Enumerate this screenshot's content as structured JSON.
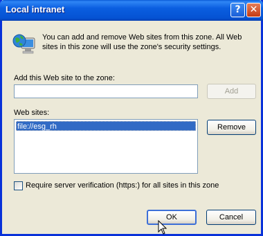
{
  "window": {
    "title": "Local intranet",
    "help_glyph": "?",
    "close_glyph": "✕"
  },
  "description": "You can add and remove Web sites from this zone. All Web sites in this zone will use the zone's security settings.",
  "add_site": {
    "label": "Add this Web site to the zone:",
    "value": "",
    "add_button": "Add",
    "add_enabled": false
  },
  "sites": {
    "label": "Web sites:",
    "items": [
      "file://esg_rh"
    ],
    "selected_index": 0,
    "remove_button": "Remove"
  },
  "require_https": {
    "label": "Require server verification (https:) for all sites in this zone",
    "checked": false
  },
  "buttons": {
    "ok": "OK",
    "cancel": "Cancel"
  },
  "colors": {
    "titlebar": "#0a5ee0",
    "selection": "#316ac5",
    "dialog_face": "#ece9d8"
  }
}
